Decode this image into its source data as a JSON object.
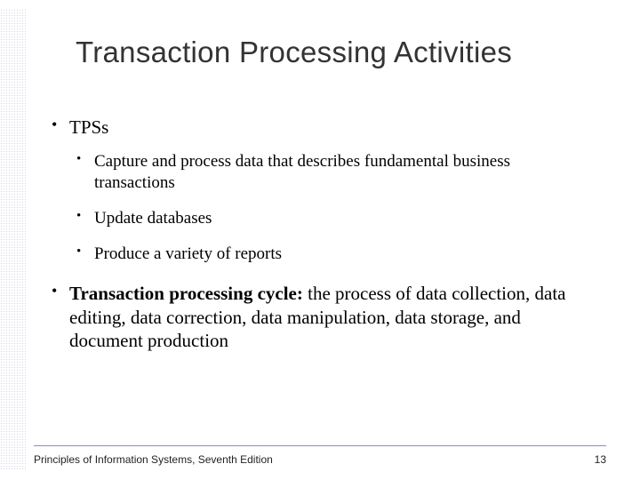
{
  "title": "Transaction Processing Activities",
  "bullets": [
    {
      "text": "TPSs",
      "children": [
        {
          "text": "Capture and process data that describes fundamental business transactions"
        },
        {
          "text": "Update databases"
        },
        {
          "text": "Produce a variety of reports"
        }
      ]
    },
    {
      "bold_lead": "Transaction processing cycle:",
      "text_rest": " the process of data collection, data editing, data correction, data manipulation, data storage, and document production"
    }
  ],
  "footer": "Principles of Information Systems, Seventh Edition",
  "page_number": "13"
}
